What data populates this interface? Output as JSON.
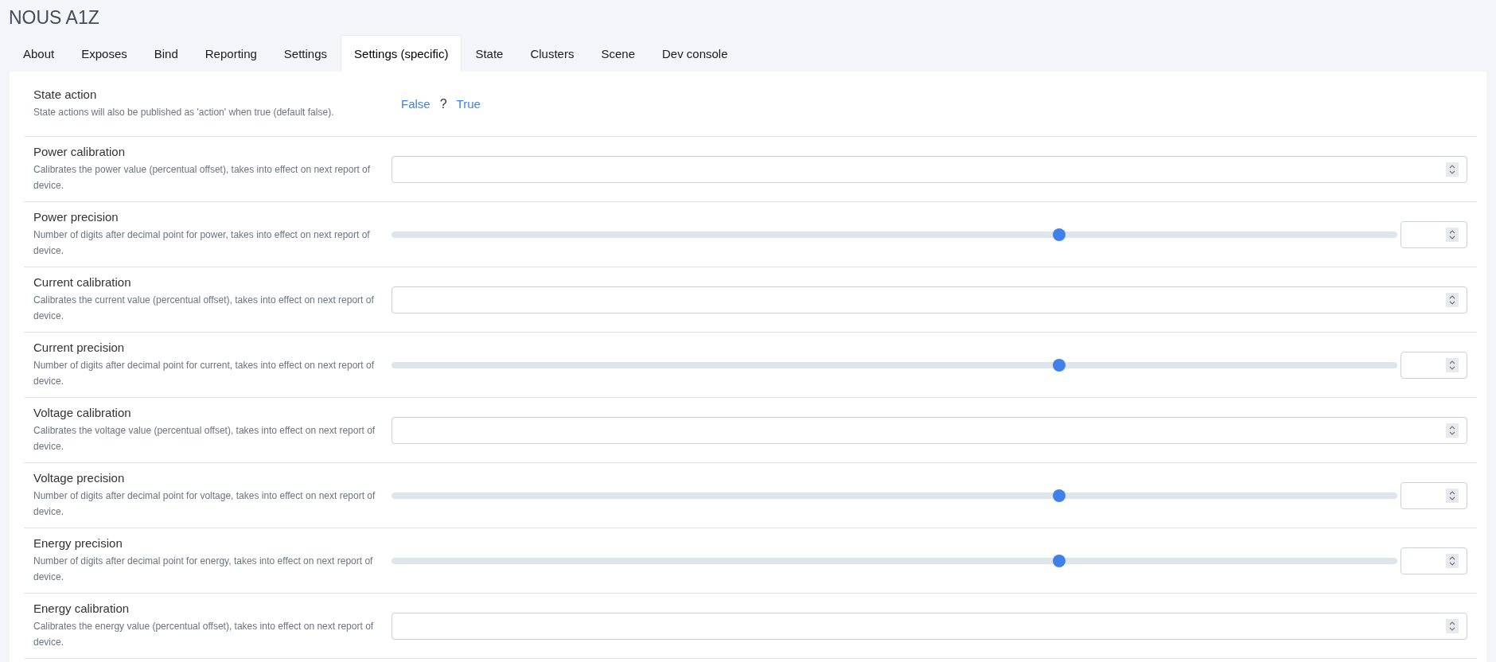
{
  "title": "NOUS A1Z",
  "tabs": [
    {
      "label": "About",
      "selected": false
    },
    {
      "label": "Exposes",
      "selected": false
    },
    {
      "label": "Bind",
      "selected": false
    },
    {
      "label": "Reporting",
      "selected": false
    },
    {
      "label": "Settings",
      "selected": false
    },
    {
      "label": "Settings (specific)",
      "selected": true
    },
    {
      "label": "State",
      "selected": false
    },
    {
      "label": "Clusters",
      "selected": false
    },
    {
      "label": "Scene",
      "selected": false
    },
    {
      "label": "Dev console",
      "selected": false
    }
  ],
  "settings": [
    {
      "kind": "toggle",
      "name": "State action",
      "description": "State actions will also be published as 'action' when true (default false).",
      "false_label": "False",
      "value": "?",
      "true_label": "True"
    },
    {
      "kind": "number",
      "name": "Power calibration",
      "description": "Calibrates the power value (percentual offset), takes into effect on next report of device."
    },
    {
      "kind": "slider",
      "name": "Power precision",
      "description": "Number of digits after decimal point for power, takes into effect on next report of device.",
      "level": 0.664
    },
    {
      "kind": "number",
      "name": "Current calibration",
      "description": "Calibrates the current value (percentual offset), takes into effect on next report of device."
    },
    {
      "kind": "slider",
      "name": "Current precision",
      "description": "Number of digits after decimal point for current, takes into effect on next report of device.",
      "level": 0.664
    },
    {
      "kind": "number",
      "name": "Voltage calibration",
      "description": "Calibrates the voltage value (percentual offset), takes into effect on next report of device."
    },
    {
      "kind": "slider",
      "name": "Voltage precision",
      "description": "Number of digits after decimal point for voltage, takes into effect on next report of device.",
      "level": 0.664
    },
    {
      "kind": "slider",
      "name": "Energy precision",
      "description": "Number of digits after decimal point for energy, takes into effect on next report of device.",
      "level": 0.664
    },
    {
      "kind": "number",
      "name": "Energy calibration",
      "description": "Calibrates the energy value (percentual offset), takes into effect on next report of device."
    }
  ]
}
